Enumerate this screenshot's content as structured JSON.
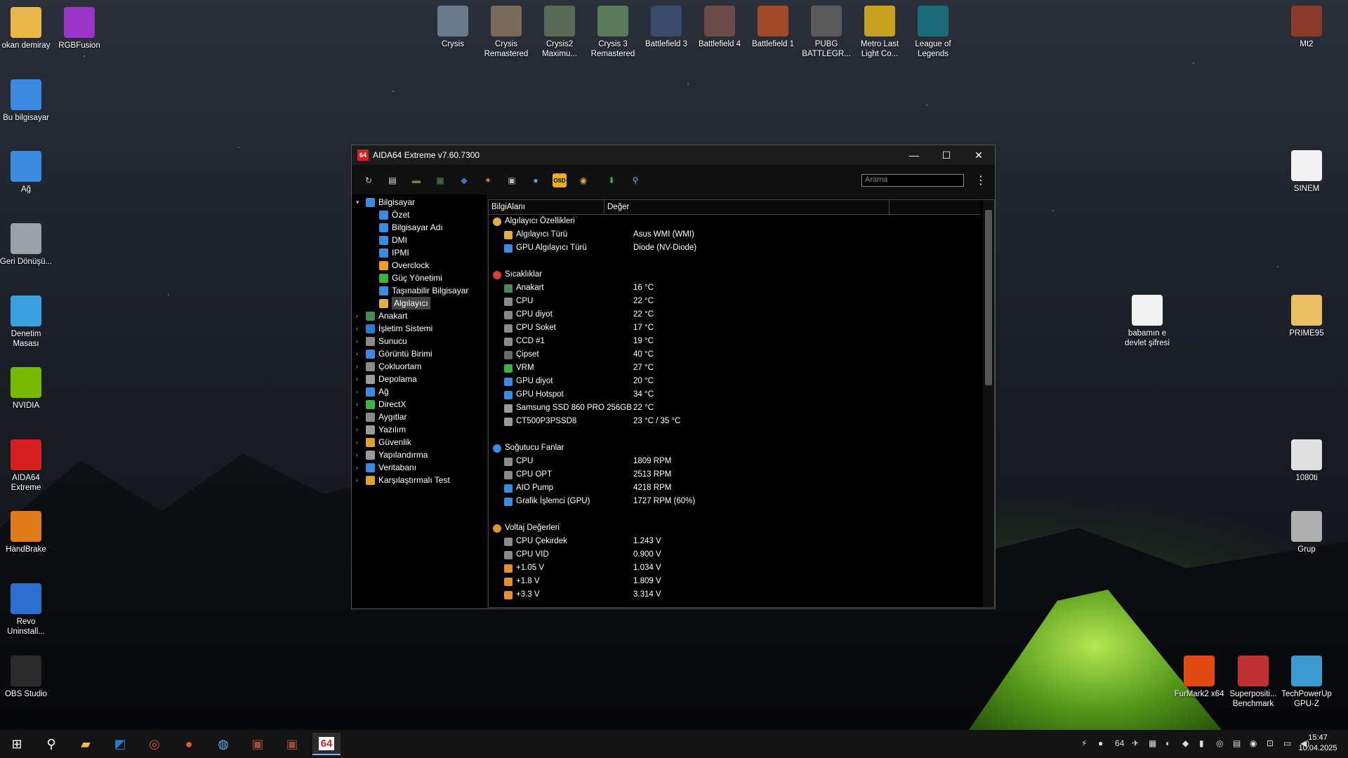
{
  "desktop": {
    "left_icons": [
      {
        "label": "okan demiray",
        "icon": "user-folder-icon",
        "color": "#e8b84a"
      },
      {
        "label": "RGBFusion",
        "icon": "rgbfusion-icon",
        "color": "#9b35c9"
      },
      {
        "label": "Bu bilgisayar",
        "icon": "computer-icon",
        "color": "#3a8be0"
      },
      {
        "label": "Ağ",
        "icon": "network-icon",
        "color": "#3a8be0"
      },
      {
        "label": "Geri Dönüşü...",
        "icon": "recycle-bin-icon",
        "color": "#9aa0a6"
      },
      {
        "label": "Denetim Masası",
        "icon": "control-panel-icon",
        "color": "#3aa0e0"
      },
      {
        "label": "NVIDIA",
        "icon": "nvidia-icon",
        "color": "#76b900"
      },
      {
        "label": "AIDA64 Extreme",
        "icon": "aida64-icon",
        "color": "#d61f1f"
      },
      {
        "label": "HandBrake",
        "icon": "handbrake-icon",
        "color": "#e07a1a"
      },
      {
        "label": "Revo Uninstall...",
        "icon": "revo-icon",
        "color": "#2a6fd0"
      },
      {
        "label": "OBS Studio",
        "icon": "obs-icon",
        "color": "#2b2b2b"
      }
    ],
    "top_icons": [
      {
        "label": "Crysis",
        "icon": "crysis-icon",
        "color": "#6a7a8a"
      },
      {
        "label": "Crysis Remastered",
        "icon": "crysis-remastered-icon",
        "color": "#7a6a5a"
      },
      {
        "label": "Crysis2 Maximu...",
        "icon": "crysis2-icon",
        "color": "#5a6a5a"
      },
      {
        "label": "Crysis 3 Remastered",
        "icon": "crysis3-icon",
        "color": "#5a7a5a"
      },
      {
        "label": "Battlefield 3",
        "icon": "battlefield3-icon",
        "color": "#3a4a6a"
      },
      {
        "label": "Battlefield 4",
        "icon": "battlefield4-icon",
        "color": "#6a4a4a"
      },
      {
        "label": "Battlefield 1",
        "icon": "battlefield1-icon",
        "color": "#a04a2a"
      },
      {
        "label": "PUBG BATTLEGR...",
        "icon": "pubg-icon",
        "color": "#5a5a5a"
      },
      {
        "label": "Metro Last Light Co...",
        "icon": "metro-icon",
        "color": "#c8a020"
      },
      {
        "label": "League of Legends",
        "icon": "lol-icon",
        "color": "#1a6a7a"
      }
    ],
    "right_icons": [
      {
        "label": "Mt2",
        "icon": "mt2-icon",
        "color": "#8a3a2a"
      },
      {
        "label": "SINEM",
        "icon": "document-icon",
        "color": "#f2f2f2"
      },
      {
        "label": "babamın e devlet şifresi",
        "icon": "document-icon",
        "color": "#f2f2f2"
      },
      {
        "label": "PRIME95",
        "icon": "folder-icon",
        "color": "#e8c060"
      },
      {
        "label": "1080ti",
        "icon": "image-icon",
        "color": "#e0e0e0"
      },
      {
        "label": "Grup",
        "icon": "photo-icon",
        "color": "#b0b0b0"
      },
      {
        "label": "FurMark2 x64",
        "icon": "furmark-icon",
        "color": "#e04a10"
      },
      {
        "label": "Superpositi... Benchmark",
        "icon": "superposition-icon",
        "color": "#c03030"
      },
      {
        "label": "TechPowerUp GPU-Z",
        "icon": "gpuz-icon",
        "color": "#3a9ad0"
      }
    ]
  },
  "window": {
    "title": "AIDA64 Extreme v7.60.7300",
    "app_icon_text": "64",
    "search_placeholder": "Arama",
    "minimize": "—",
    "maximize": "☐",
    "close": "✕",
    "menu": "⋮"
  },
  "toolbar": [
    {
      "icon": "refresh-icon",
      "glyph": "↻",
      "color": "#cccccc"
    },
    {
      "icon": "report-icon",
      "glyph": "▤",
      "color": "#e8e8e8"
    },
    {
      "icon": "motherboard-icon",
      "glyph": "▬",
      "color": "#6a8a4a"
    },
    {
      "icon": "memory-icon",
      "glyph": "▦",
      "color": "#4a8a5a"
    },
    {
      "icon": "network-audit-icon",
      "glyph": "◆",
      "color": "#3a7ad0"
    },
    {
      "icon": "flame-icon",
      "glyph": "✶",
      "color": "#f0a020"
    },
    {
      "icon": "stability-icon",
      "glyph": "▣",
      "color": "#bbbbbb"
    },
    {
      "icon": "user-icon",
      "glyph": "●",
      "color": "#5aa0e0"
    },
    {
      "icon": "osd-icon",
      "glyph": "OSD",
      "color": "#e8b020"
    },
    {
      "icon": "sensor-icon",
      "glyph": "◉",
      "color": "#e0b040"
    },
    {
      "icon": "download-icon",
      "glyph": "⬇",
      "color": "#30c030"
    },
    {
      "icon": "search-icon",
      "glyph": "⚲",
      "color": "#5ab0f0"
    }
  ],
  "tree": {
    "root": {
      "label": "Bilgisayar",
      "color": "#3a8be0"
    },
    "children": [
      {
        "label": "Özet",
        "color": "#3a8be0"
      },
      {
        "label": "Bilgisayar Adı",
        "color": "#3a8be0"
      },
      {
        "label": "DMI",
        "color": "#3a8be0"
      },
      {
        "label": "IPMI",
        "color": "#3a8be0"
      },
      {
        "label": "Overclock",
        "color": "#f0a020"
      },
      {
        "label": "Güç Yönetimi",
        "color": "#40b040"
      },
      {
        "label": "Taşınabilir Bilgisayar",
        "color": "#3a8be0"
      },
      {
        "label": "Algılayıcı",
        "color": "#e0b040",
        "selected": true
      }
    ],
    "groups": [
      {
        "label": "Anakart",
        "color": "#4a8a5a"
      },
      {
        "label": "İşletim Sistemi",
        "color": "#2a7ad0"
      },
      {
        "label": "Sunucu",
        "color": "#8a8a8a"
      },
      {
        "label": "Görüntü Birimi",
        "color": "#3a8be0"
      },
      {
        "label": "Çokluortam",
        "color": "#8a8a8a"
      },
      {
        "label": "Depolama",
        "color": "#9a9a9a"
      },
      {
        "label": "Ağ",
        "color": "#3a8be0"
      },
      {
        "label": "DirectX",
        "color": "#40b040"
      },
      {
        "label": "Aygıtlar",
        "color": "#8a8a8a"
      },
      {
        "label": "Yazılım",
        "color": "#9a9a9a"
      },
      {
        "label": "Güvenlik",
        "color": "#e0a030"
      },
      {
        "label": "Yapılandırma",
        "color": "#9a9a9a"
      },
      {
        "label": "Veritabanı",
        "color": "#3a8be0"
      },
      {
        "label": "Karşılaştırmalı Test",
        "color": "#e0a030"
      }
    ]
  },
  "panel": {
    "col1": "BilgiAlanı",
    "col2": "Değer",
    "rows": [
      {
        "type": "section",
        "label": "Algılayıcı Özellikleri",
        "color": "#e0b040"
      },
      {
        "label": "Algılayıcı Türü",
        "value": "Asus WMI  (WMI)",
        "color": "#e0b040"
      },
      {
        "label": "GPU Algılayıcı Türü",
        "value": "Diode  (NV-Diode)",
        "color": "#3a8be0"
      },
      {
        "type": "gap"
      },
      {
        "type": "section",
        "label": "Sıcaklıklar",
        "color": "#d04040"
      },
      {
        "label": "Anakart",
        "value": "16 °C",
        "color": "#4a8a5a"
      },
      {
        "label": "CPU",
        "value": "22 °C",
        "color": "#8a8a8a"
      },
      {
        "label": "CPU diyot",
        "value": "22 °C",
        "color": "#8a8a8a"
      },
      {
        "label": "CPU Soket",
        "value": "17 °C",
        "color": "#8a8a8a"
      },
      {
        "label": "CCD #1",
        "value": "19 °C",
        "color": "#8a8a8a"
      },
      {
        "label": "Çipset",
        "value": "40 °C",
        "color": "#6a6a6a"
      },
      {
        "label": "VRM",
        "value": "27 °C",
        "color": "#40b040"
      },
      {
        "label": "GPU diyot",
        "value": "20 °C",
        "color": "#3a8be0"
      },
      {
        "label": "GPU Hotspot",
        "value": "34 °C",
        "color": "#3a8be0"
      },
      {
        "label": "Samsung SSD 860 PRO 256GB",
        "value": "22 °C",
        "color": "#9a9a9a"
      },
      {
        "label": "CT500P3PSSD8",
        "value": "23 °C / 35 °C",
        "color": "#9a9a9a"
      },
      {
        "type": "gap"
      },
      {
        "type": "section",
        "label": "Soğutucu Fanlar",
        "color": "#3a8be0"
      },
      {
        "label": "CPU",
        "value": "1809 RPM",
        "color": "#8a8a8a"
      },
      {
        "label": "CPU OPT",
        "value": "2513 RPM",
        "color": "#8a8a8a"
      },
      {
        "label": "AIO Pump",
        "value": "4218 RPM",
        "color": "#3a8be0"
      },
      {
        "label": "Grafik İşlemci (GPU)",
        "value": "1727 RPM  (60%)",
        "color": "#3a8be0"
      },
      {
        "type": "gap"
      },
      {
        "type": "section",
        "label": "Voltaj Değerleri",
        "color": "#e09030"
      },
      {
        "label": "CPU Çekirdek",
        "value": "1.243 V",
        "color": "#8a8a8a"
      },
      {
        "label": "CPU VID",
        "value": "0.900 V",
        "color": "#8a8a8a"
      },
      {
        "label": "+1.05 V",
        "value": "1.034 V",
        "color": "#e09030"
      },
      {
        "label": "+1.8 V",
        "value": "1.809 V",
        "color": "#e09030"
      },
      {
        "label": "+3.3 V",
        "value": "3.314 V",
        "color": "#e09030"
      }
    ]
  },
  "taskbar": {
    "items": [
      {
        "icon": "start-icon",
        "glyph": "⊞",
        "color": "#ffffff"
      },
      {
        "icon": "search-icon",
        "glyph": "⚲",
        "color": "#ffffff"
      },
      {
        "icon": "file-explorer-icon",
        "glyph": "▰",
        "color": "#f0c040"
      },
      {
        "icon": "outlook-icon",
        "glyph": "◩",
        "color": "#2a7ad0"
      },
      {
        "icon": "chrome-icon",
        "glyph": "◎",
        "color": "#e04a3a"
      },
      {
        "icon": "ea-icon",
        "glyph": "●",
        "color": "#e05a2a"
      },
      {
        "icon": "steam-icon",
        "glyph": "◍",
        "color": "#5ab0e0"
      },
      {
        "icon": "game-icon",
        "glyph": "▣",
        "color": "#a04a3a"
      },
      {
        "icon": "game2-icon",
        "glyph": "▣",
        "color": "#a04a3a"
      },
      {
        "icon": "aida64-icon",
        "glyph": "64",
        "color": "#d61f1f",
        "active": true
      }
    ],
    "tray_icons": [
      "⚡",
      "●",
      "64",
      "✈",
      "▦",
      "◐",
      "◆",
      "▮",
      "◎",
      "▤",
      "◉",
      "⊡",
      "▭",
      "◀)"
    ],
    "time": "15:47",
    "date": "10.04.2025"
  }
}
